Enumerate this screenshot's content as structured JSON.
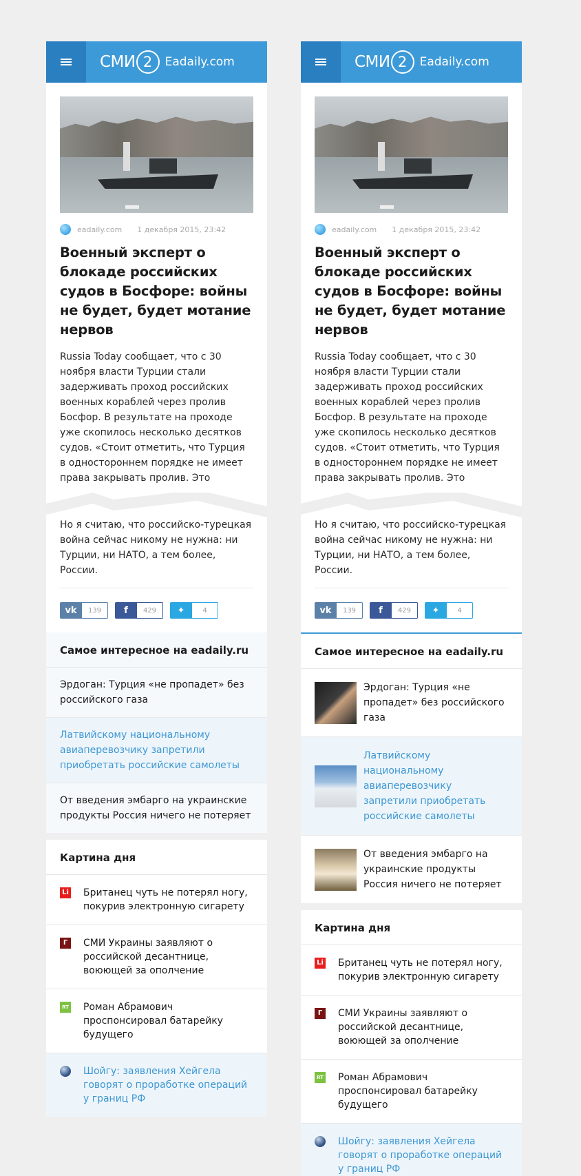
{
  "header": {
    "smi": "СМИ",
    "two": "2",
    "site": "Eadaily.com"
  },
  "article": {
    "source": "eadaily.com",
    "date": "1 декабря 2015, 23:42",
    "title": "Военный эксперт о блокаде российских судов в Босфоре: войны не будет, будет мотание нервов",
    "lead": "Russia Today сообщает, что с 30 ноября власти Турции стали задерживать проход российских военных кораблей через пролив Босфор. В результате на проходе уже скопилось несколько десятков судов. «Стоит отметить, что Турция в одностороннем порядке не имеет права закрывать пролив. Это",
    "more": "Но я считаю, что российско-турецкая война сейчас никому не нужна: ни Турции, ни НАТО, а тем более, России."
  },
  "share": {
    "vk": "139",
    "fb": "429",
    "tw": "4",
    "vk_icon": "vk-icon",
    "fb_icon": "f",
    "tw_icon": "twitter-icon"
  },
  "interesting": {
    "title": "Самое интересное на eadaily.ru",
    "items": [
      "Эрдоган: Турция «не пропадет» без российского газа",
      "Латвийскому национальному авиаперевозчику запретили приобретать российские самолеты",
      "От введения эмбарго на украинские продукты Россия ничего не потеряет"
    ]
  },
  "kartina": {
    "title": "Картина дня",
    "items": [
      {
        "text": "Британец чуть не потерял ногу, покурив электронную сигарету",
        "icon": "Li"
      },
      {
        "text": "СМИ Украины заявляют о российской десантнице, воюющей за ополчение",
        "icon": "Г"
      },
      {
        "text": "Роман Абрамович проспонсировал батарейку будущего",
        "icon": "RT"
      },
      {
        "text": "Шойгу: заявления Хейгела говорят о проработке операций у границ РФ",
        "icon": ""
      }
    ]
  },
  "colors": {
    "accent": "#3d9ad8",
    "highlight": "#3d97d3"
  }
}
